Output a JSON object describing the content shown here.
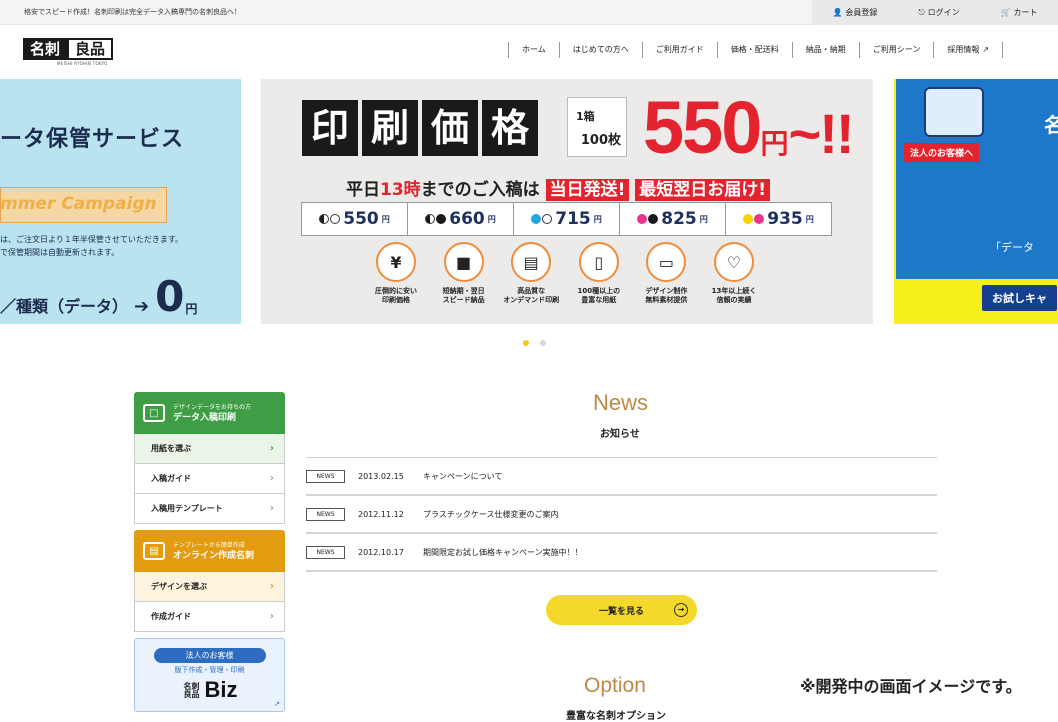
{
  "top": {
    "message": "格安でスピード作成！名刺印刷は完全データ入稿専門の名刺良品へ！",
    "member": "会員登録",
    "login": "ログイン",
    "cart": "カート"
  },
  "logo": {
    "mark1": "名刺",
    "mark2": "良品",
    "sub": "MEISHI RYOHIN TOKYO"
  },
  "nav": [
    "ホーム",
    "はじめての方へ",
    "ご利用ガイド",
    "価格・配送料",
    "納品・納期",
    "ご利用シーン",
    "採用情報"
  ],
  "slides": {
    "left": {
      "title": "ータ保管サービス",
      "campaign": "mmer Campaign",
      "note1": "は、ご注文日より１年半保管させていただきます。",
      "note2": "で保管期間は自動更新されます。",
      "bottom": "／種類（データ）",
      "price": "0",
      "yen": "円"
    },
    "center": {
      "kanji": [
        "印",
        "刷",
        "価",
        "格"
      ],
      "box1": "1箱",
      "box2": "100枚",
      "price": "550",
      "price_suffix": "~!!",
      "price_yen": "円",
      "sub_1": "平日",
      "sub_hour": "13時",
      "sub_2": "までのご入稿は",
      "sub_tag1": "当日発送!",
      "sub_tag2": "最短翌日お届け!",
      "prices": [
        "550",
        "660",
        "715",
        "825",
        "935"
      ],
      "yen": "円",
      "features": [
        {
          "icon": "¥",
          "label1": "圧倒的に安い",
          "label2": "印刷価格"
        },
        {
          "icon": "■",
          "label1": "短納期・翌日",
          "label2": "スピード納品"
        },
        {
          "icon": "▤",
          "label1": "高品質な",
          "label2": "オンデマンド印刷"
        },
        {
          "icon": "▯",
          "label1": "100種以上の",
          "label2": "豊富な用紙"
        },
        {
          "icon": "▭",
          "label1": "デザイン制作",
          "label2": "無料素材提供"
        },
        {
          "icon": "♡",
          "label1": "13年以上続く",
          "label2": "信頼の実績"
        }
      ]
    },
    "right": {
      "badge": "法人のお客様へ",
      "char": "名",
      "text": "「データ",
      "trial": "お試しキャ"
    }
  },
  "sidebar": {
    "group1": {
      "head1": "デザインデータをお持ちの方",
      "head2": "データ入稿印刷",
      "items": [
        "用紙を選ぶ",
        "入稿ガイド",
        "入稿用テンプレート"
      ]
    },
    "group2": {
      "head1": "テンプレートから簡単作成",
      "head2": "オンライン作成名刺",
      "items": [
        "デザインを選ぶ",
        "作成ガイド"
      ]
    },
    "biz": {
      "pill": "法人のお客様",
      "sub": "版下作成・管理・印刷",
      "mark": "名刺良品",
      "name": "Biz"
    }
  },
  "news": {
    "title": "News",
    "subtitle": "お知らせ",
    "items": [
      {
        "tag": "NEWS",
        "date": "2013.02.15",
        "text": "キャンペーンについて"
      },
      {
        "tag": "NEWS",
        "date": "2012.11.12",
        "text": "プラスチックケース仕様変更のご案内"
      },
      {
        "tag": "NEWS",
        "date": "2012.10.17",
        "text": "期間限定お試し価格キャンペーン実施中！！"
      }
    ],
    "more": "一覧を見る"
  },
  "option": {
    "title": "Option",
    "subtitle": "豊富な名刺オプション"
  },
  "dev_note": "※開発中の画面イメージです。",
  "colors": {
    "accent_gold": "#bc8a46",
    "green": "#3f9d46",
    "orange": "#e39c10",
    "red": "#e3232e",
    "yellow": "#f4d92b"
  }
}
